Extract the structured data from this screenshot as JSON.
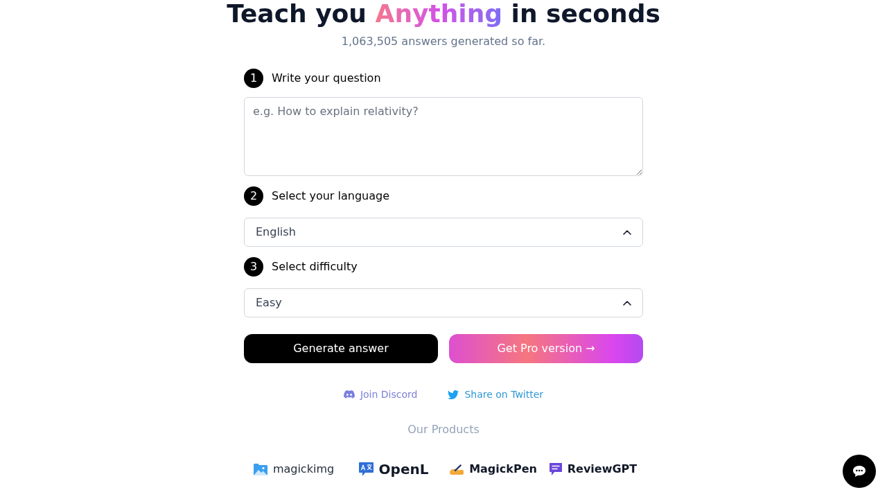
{
  "headline": {
    "parts": [
      {
        "text": "Teach you",
        "highlight": false
      },
      {
        "text": "Anything",
        "highlight": true
      },
      {
        "text": "in seconds",
        "highlight": false
      }
    ]
  },
  "counter": "1,063,505 answers generated so far.",
  "steps": [
    {
      "number": "1",
      "label": "Write your question",
      "kind": "textarea",
      "placeholder": "e.g. How to explain relativity?"
    },
    {
      "number": "2",
      "label": "Select your language",
      "kind": "select",
      "value": "English"
    },
    {
      "number": "3",
      "label": "Select difficulty",
      "kind": "select",
      "value": "Easy"
    }
  ],
  "buttons": [
    {
      "label": "Generate answer",
      "kind": "primary"
    },
    {
      "label": "Get Pro version →",
      "kind": "gradient"
    }
  ],
  "links": [
    {
      "label": "Join Discord",
      "kind": "discord"
    },
    {
      "label": "Share on Twitter",
      "kind": "twitter"
    }
  ],
  "products_title": "Our Products",
  "products": [
    {
      "name": "magickimg",
      "kind": "image"
    },
    {
      "name": "OpenL",
      "kind": "translate"
    },
    {
      "name": "MagickPen",
      "kind": "pen"
    },
    {
      "name": "ReviewGPT",
      "kind": "review"
    }
  ]
}
